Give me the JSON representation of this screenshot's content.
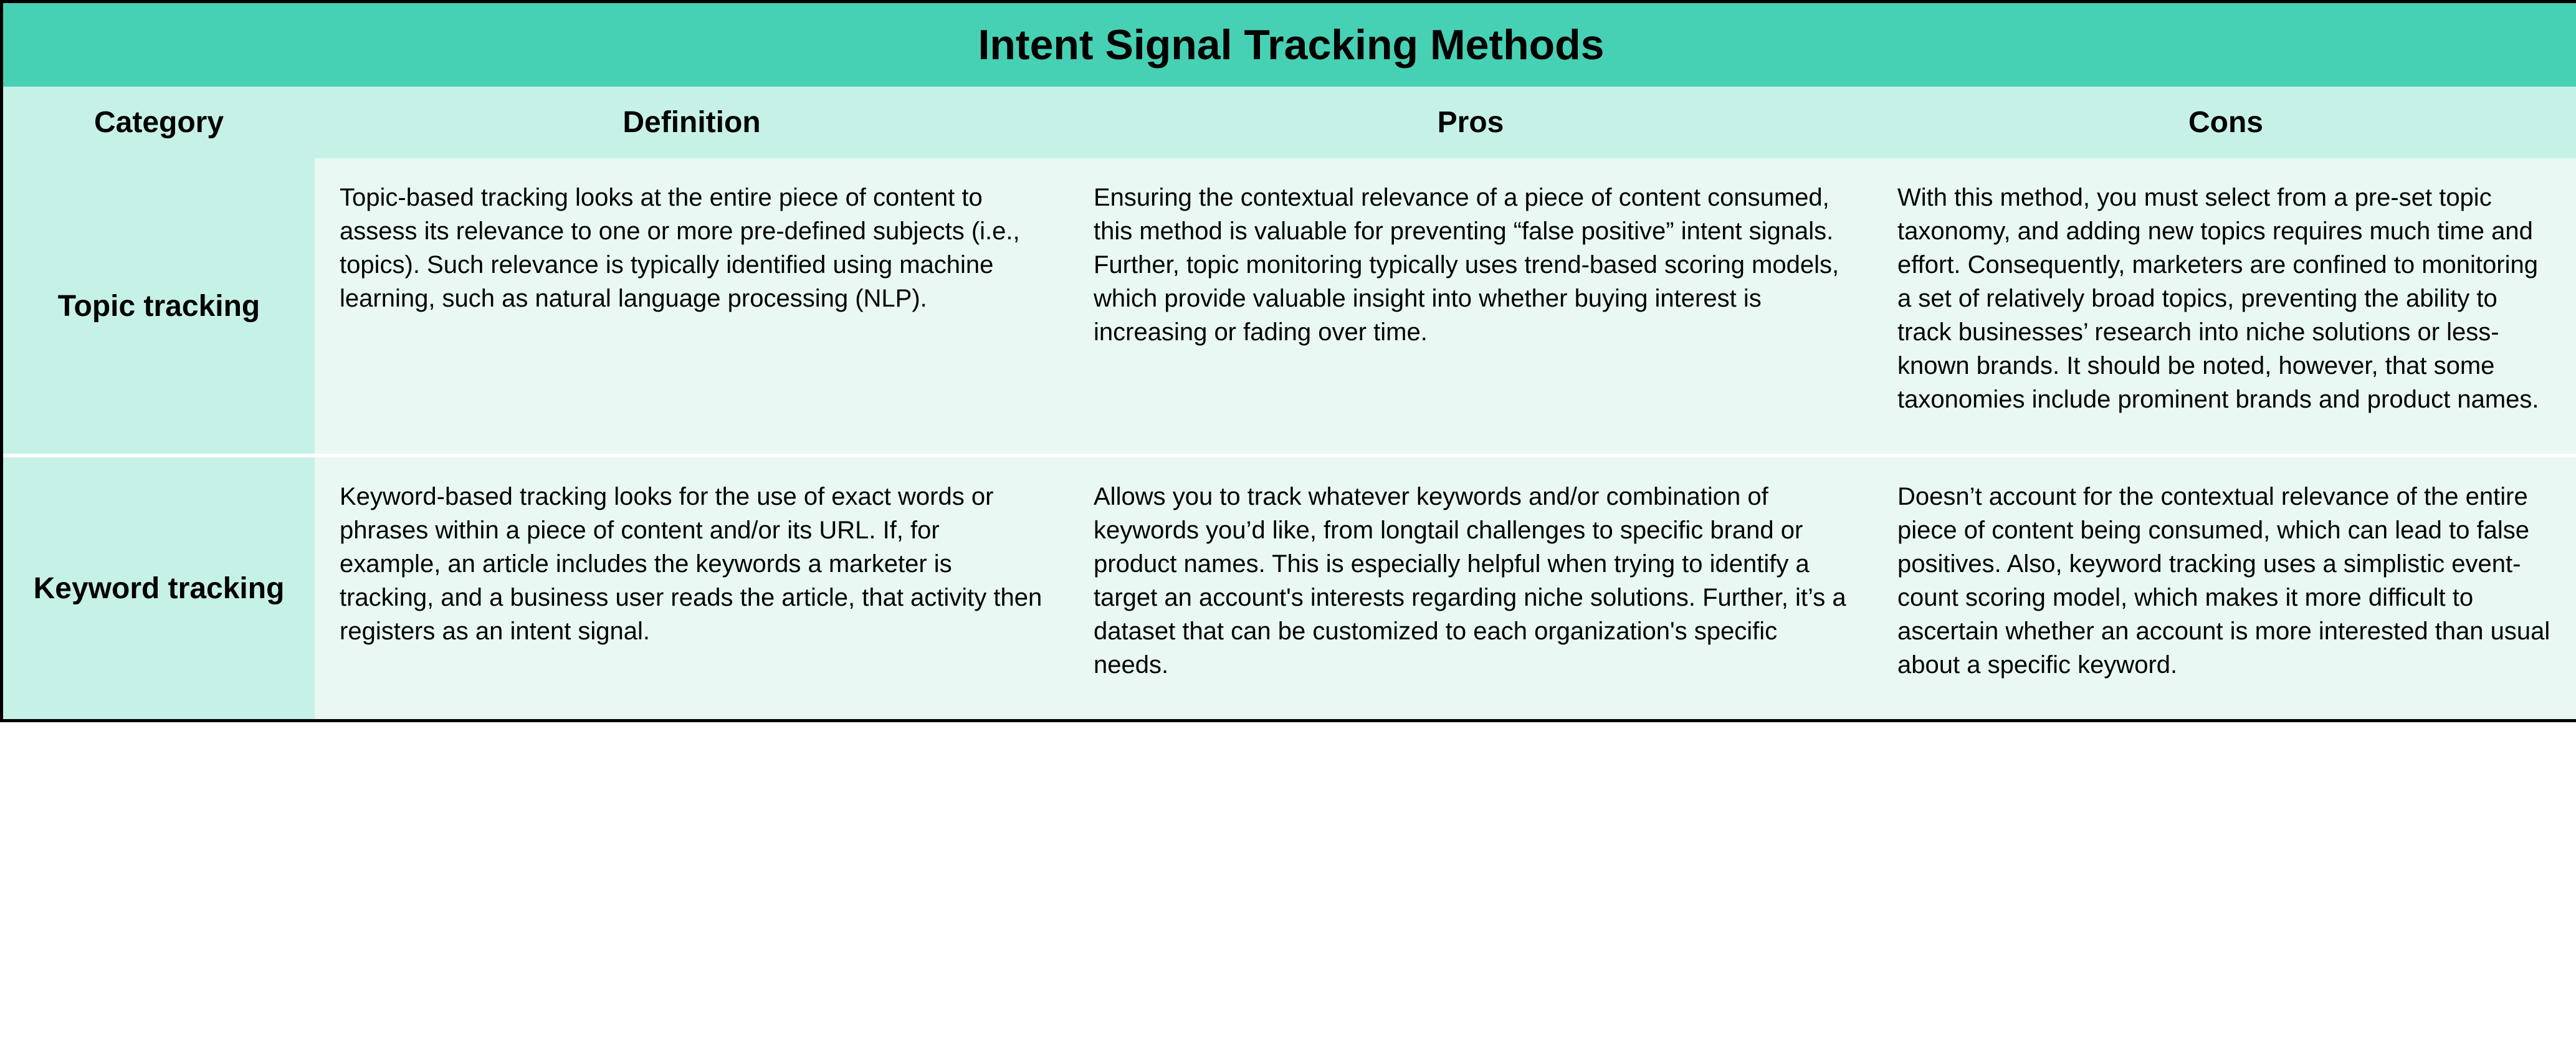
{
  "title": "Intent Signal Tracking Methods",
  "headers": {
    "category": "Category",
    "definition": "Definition",
    "pros": "Pros",
    "cons": "Cons"
  },
  "rows": [
    {
      "category": "Topic tracking",
      "definition": "Topic-based tracking looks at the entire piece of content to assess its relevance to one or more pre-defined subjects (i.e., topics). Such relevance is typically identified using machine learning, such as natural language processing (NLP).",
      "pros": "Ensuring the contextual relevance of a piece of content consumed, this method is valuable for preventing “false positive” intent signals. Further, topic monitoring typically uses trend-based scoring models, which provide valuable insight into whether buying interest is increasing or fading over time.",
      "cons": "With this method, you must select from a pre-set topic taxonomy, and adding new topics requires much time and effort. Consequently, marketers are confined to monitoring a set of relatively broad topics, preventing the ability to track businesses’ research into niche solutions or less-known brands. It should be noted, however, that some taxonomies include prominent brands and product names."
    },
    {
      "category": "Keyword tracking",
      "definition": "Keyword-based tracking looks for the use of exact words or phrases within a piece of content and/or its URL. If, for example, an article includes the keywords a marketer is tracking, and a business user reads the article, that activity then registers as an intent signal.",
      "pros": "Allows you to track whatever keywords and/or combination of keywords you’d like, from longtail challenges to specific brand or product names. This is especially helpful when trying to identify a target an account's interests regarding niche solutions. Further, it’s a dataset that can be customized to each organization's specific needs.",
      "cons": "Doesn’t account for the contextual relevance of the entire piece of content being consumed, which can lead to false positives. Also, keyword tracking uses a simplistic event-count scoring model, which makes it more difficult to ascertain whether an account is more interested than usual about a specific keyword."
    }
  ]
}
